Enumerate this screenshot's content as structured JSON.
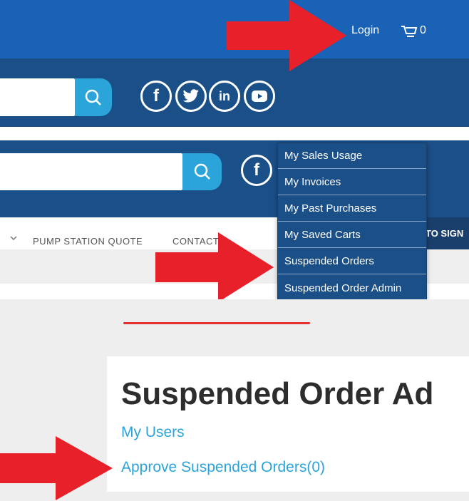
{
  "panel1": {
    "login_label": "Login",
    "cart_count": "0",
    "search": {
      "placeholder": ""
    },
    "social": [
      "facebook-icon",
      "twitter-icon",
      "linkedin-icon",
      "youtube-icon"
    ]
  },
  "panel2": {
    "menu": {
      "pump_station_quote": "PUMP STATION QUOTE",
      "contact": "CONTACT",
      "sign_partial": "TO SIGN"
    },
    "dropdown": [
      "My Sales Usage",
      "My Invoices",
      "My Past Purchases",
      "My Saved Carts",
      "Suspended Orders",
      "Suspended Order Admin"
    ]
  },
  "panel3": {
    "title": "Suspended Order Ad",
    "links": [
      "My Users",
      "Approve Suspended Orders(0)"
    ]
  },
  "colors": {
    "top_bar": "#1a62b6",
    "nav_bar": "#1b4f88",
    "accent": "#2ba4da",
    "arrow": "#e8202a"
  }
}
